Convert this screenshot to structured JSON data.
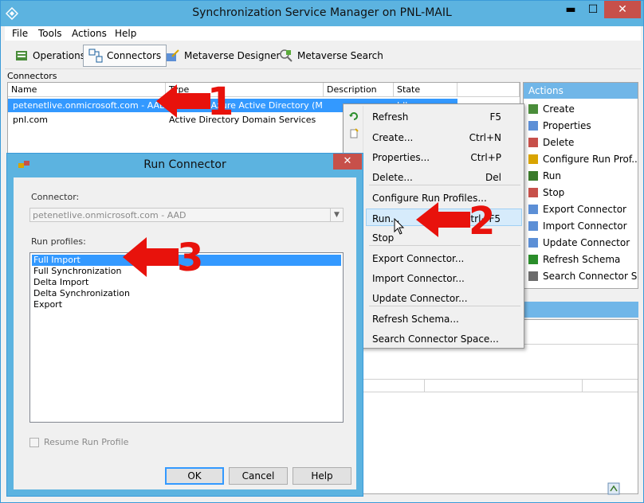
{
  "window": {
    "title": "Synchronization Service Manager on PNL-MAIL",
    "controls": {
      "minimize": "▬",
      "maximize": "☐",
      "close": "✕"
    }
  },
  "menu": [
    "File",
    "Tools",
    "Actions",
    "Help"
  ],
  "toolbar": [
    {
      "label": "Operations",
      "icon": "operations-icon"
    },
    {
      "label": "Connectors",
      "icon": "connectors-icon",
      "active": true
    },
    {
      "label": "Metaverse Designer",
      "icon": "metaverse-designer-icon"
    },
    {
      "label": "Metaverse Search",
      "icon": "metaverse-search-icon"
    }
  ],
  "connectors": {
    "section_label": "Connectors",
    "columns": [
      "Name",
      "Type",
      "Description",
      "State"
    ],
    "rows": [
      {
        "name": "petenetlive.onmicrosoft.com - AAD",
        "type": "Windows Azure Active Directory (Micr...",
        "description": "",
        "state": "Idle",
        "selected": true
      },
      {
        "name": "pnl.com",
        "type": "Active Directory Domain Services",
        "description": "",
        "state": ""
      }
    ]
  },
  "actions": {
    "header": "Actions",
    "items": [
      "Create",
      "Properties",
      "Delete",
      "Configure Run Prof...",
      "Run",
      "Stop",
      "Export Connector",
      "Import Connector",
      "Update Connector",
      "Refresh Schema",
      "Search Connector S..."
    ]
  },
  "context_menu": {
    "items": [
      {
        "label": "Refresh",
        "shortcut": "F5"
      },
      {
        "label": "Create...",
        "shortcut": "Ctrl+N"
      },
      {
        "label": "Properties...",
        "shortcut": "Ctrl+P"
      },
      {
        "label": "Delete...",
        "shortcut": "Del"
      },
      {
        "label": "Configure Run Profiles...",
        "shortcut": ""
      },
      {
        "label": "Run...",
        "shortcut": "Ctrl+F5",
        "highlighted": true
      },
      {
        "label": "Stop",
        "shortcut": ""
      },
      {
        "label": "Export Connector...",
        "shortcut": ""
      },
      {
        "label": "Import Connector...",
        "shortcut": ""
      },
      {
        "label": "Update Connector...",
        "shortcut": ""
      },
      {
        "label": "Refresh Schema...",
        "shortcut": ""
      },
      {
        "label": "Search Connector Space...",
        "shortcut": ""
      }
    ]
  },
  "dialog": {
    "title": "Run Connector",
    "connector_label": "Connector:",
    "connector_value": "petenetlive.onmicrosoft.com - AAD",
    "profiles_label": "Run profiles:",
    "profiles": [
      "Full Import",
      "Full Synchronization",
      "Delta Import",
      "Delta Synchronization",
      "Export"
    ],
    "selected_profile": "Full Import",
    "resume_label": "Resume Run Profile",
    "ok_label": "OK",
    "cancel_label": "Cancel",
    "help_label": "Help"
  },
  "callouts": [
    "1",
    "2",
    "3"
  ],
  "colors": {
    "title_bar": "#5cb3e0",
    "selection": "#3399ff",
    "close_button": "#c7504a",
    "callout": "#e8120c",
    "actions_header": "#70b6e8"
  }
}
